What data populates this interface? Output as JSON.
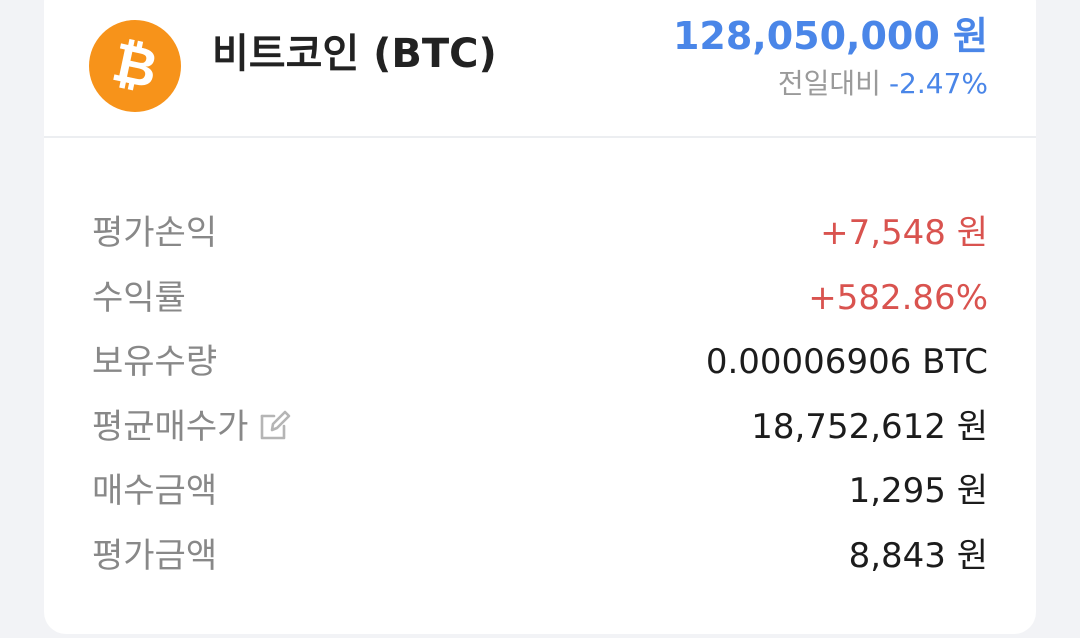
{
  "coin": {
    "name": "비트코인 (BTC)",
    "logo_symbol": "₿",
    "logo_color": "#f7931a",
    "icon": "bitcoin-icon"
  },
  "price": {
    "current": "128,050,000 원",
    "change_label": "전일대비",
    "change_value": "-2.47%",
    "color": "#4a86e8"
  },
  "details": [
    {
      "label": "평가손익",
      "value": "+7,548 원",
      "emphasis": "red"
    },
    {
      "label": "수익률",
      "value": "+582.86%",
      "emphasis": "red"
    },
    {
      "label": "보유수량",
      "value": "0.00006906 BTC",
      "emphasis": "normal"
    },
    {
      "label": "평균매수가",
      "value": "18,752,612 원",
      "emphasis": "normal",
      "icon": "edit-icon"
    },
    {
      "label": "매수금액",
      "value": "1,295 원",
      "emphasis": "normal"
    },
    {
      "label": "평가금액",
      "value": "8,843 원",
      "emphasis": "normal"
    }
  ],
  "colors": {
    "positive": "#d9534f",
    "negative": "#4a86e8"
  }
}
